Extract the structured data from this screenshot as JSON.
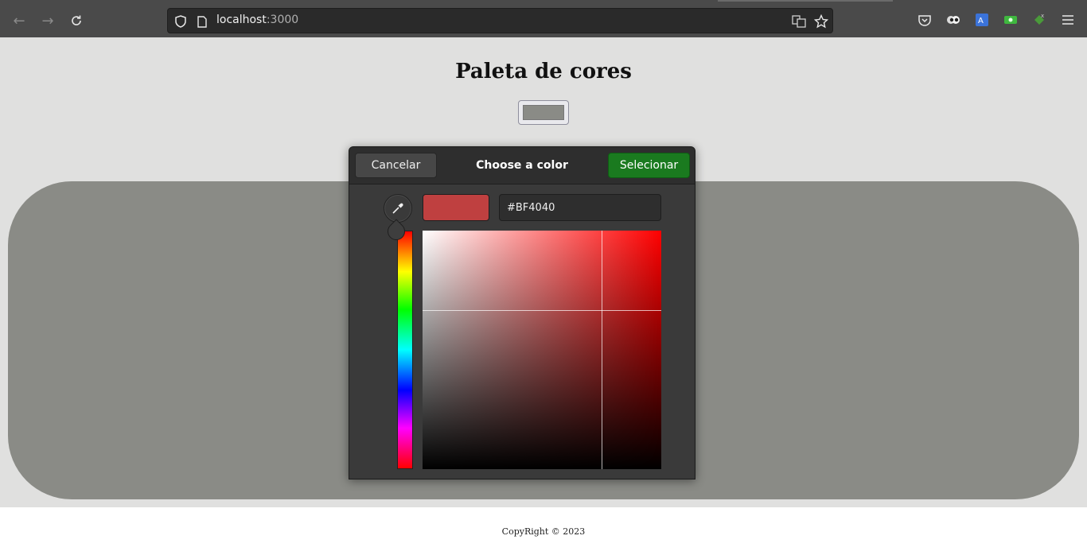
{
  "browser": {
    "url_host": "localhost",
    "url_port": ":3000"
  },
  "page": {
    "title": "Paleta de cores",
    "input_color": "#8a8b86",
    "preview_color": "#8a8b86",
    "footer": "CopyRight © 2023"
  },
  "dialog": {
    "title": "Choose a color",
    "cancel_label": "Cancelar",
    "select_label": "Selecionar",
    "hex_value": "#BF4040",
    "selected_color": "#BF4040",
    "hue_color": "#ff0000"
  }
}
